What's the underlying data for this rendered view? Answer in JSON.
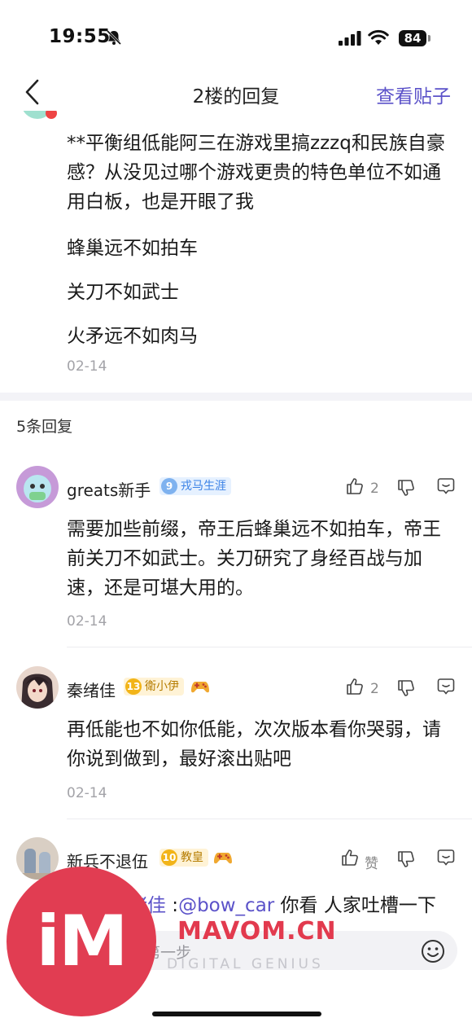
{
  "status_bar": {
    "time": "19:55",
    "battery": "84"
  },
  "nav": {
    "title": "2楼的回复",
    "right_link": "查看贴子"
  },
  "post": {
    "text": "**平衡组低能阿三在游戏里搞zzzq和民族自豪感？从没见过哪个游戏更贵的特色单位不如通用白板，也是开眼了我",
    "lines": [
      "蜂巢远不如拍车",
      "关刀不如武士",
      "火矛远不如肉马"
    ],
    "date": "02-14"
  },
  "replies_header": "5条回复",
  "comments": [
    {
      "username": "greats新手",
      "level": "9",
      "title": "戎马生涯",
      "likes": "2",
      "text": "需要加些前缀，帝王后蜂巢远不如拍车，帝王前关刀不如武士。关刀研究了身经百战与加速，还是可堪大用的。",
      "date": "02-14"
    },
    {
      "username": "秦绪佳",
      "level": "13",
      "title": "衛小伊",
      "likes": "2",
      "text": "再低能也不如你低能，次次版本看你哭弱，请你说到做到，最好滚出贴吧",
      "date": "02-14"
    },
    {
      "username": "新兵不退伍",
      "level": "10",
      "title": "教皇",
      "likes": "赞"
    }
  ],
  "partial_reply": {
    "name_fragment": "绪佳",
    "colon": " :",
    "mention": "@bow_car",
    "rest": " 你看 人家吐槽一下"
  },
  "input": {
    "placeholder": "第一步"
  },
  "watermark": {
    "logo": "iM",
    "brand": "MAVOM.CN",
    "tagline": "DIGITAL GENIUS"
  },
  "colors": {
    "accent": "#5b52c9",
    "watermark": "#e13d52",
    "date": "#a3a3a8"
  }
}
